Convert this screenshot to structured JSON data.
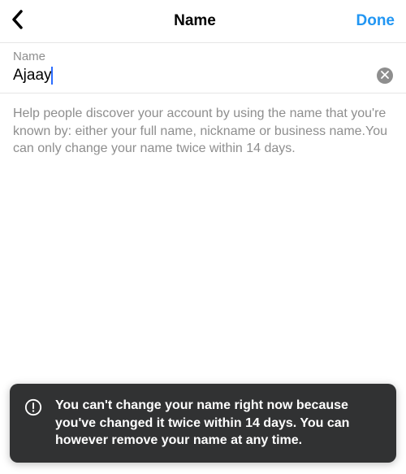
{
  "header": {
    "title": "Name",
    "done_label": "Done"
  },
  "field": {
    "label": "Name",
    "value": "Ajaay"
  },
  "help_text": "Help people discover your account by using the name that you're known by: either your full name, nickname or business name.You can only change your name twice within 14 days.",
  "toast": {
    "message": "You can't change your name right now because you've changed it twice within 14 days. You can however remove your name at any time."
  }
}
